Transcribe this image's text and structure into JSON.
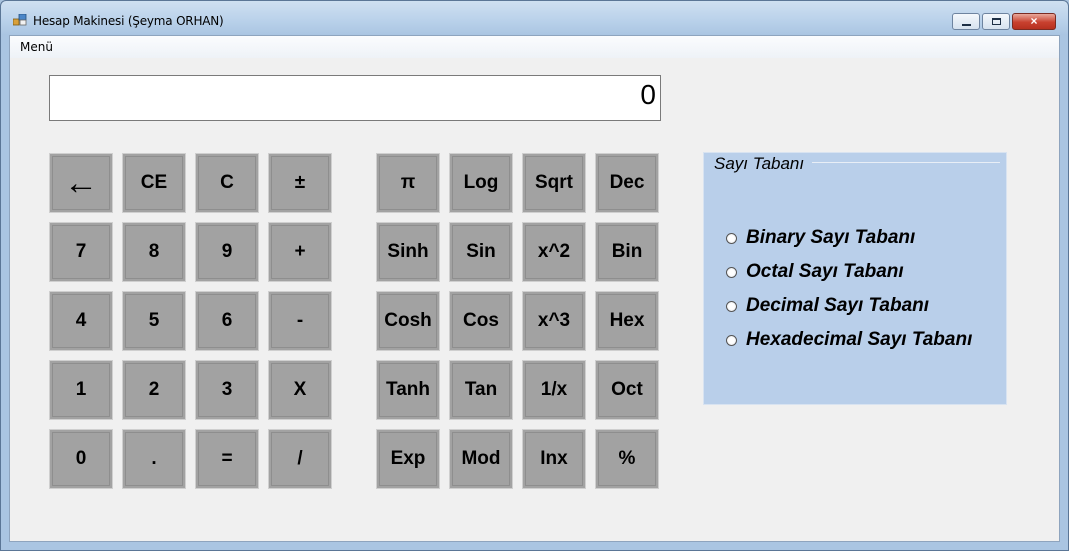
{
  "window": {
    "title": "Hesap Makinesi (Şeyma ORHAN)",
    "controls": {
      "minimize": "minimize-icon",
      "maximize": "maximize-icon",
      "close": "×"
    }
  },
  "menu": {
    "items": [
      "Menü"
    ]
  },
  "display": {
    "value": "0"
  },
  "keypad": {
    "basic": [
      [
        "←",
        "CE",
        "C",
        "±"
      ],
      [
        "7",
        "8",
        "9",
        "+"
      ],
      [
        "4",
        "5",
        "6",
        "-"
      ],
      [
        "1",
        "2",
        "3",
        "X"
      ],
      [
        "0",
        ".",
        "=",
        "/"
      ]
    ],
    "scientific": [
      [
        "π",
        "Log",
        "Sqrt",
        "Dec"
      ],
      [
        "Sinh",
        "Sin",
        "x^2",
        "Bin"
      ],
      [
        "Cosh",
        "Cos",
        "x^3",
        "Hex"
      ],
      [
        "Tanh",
        "Tan",
        "1/x",
        "Oct"
      ],
      [
        "Exp",
        "Mod",
        "Inx",
        "%"
      ]
    ]
  },
  "number_base": {
    "title": "Sayı Tabanı",
    "options": [
      "Binary Sayı Tabanı",
      "Octal Sayı Tabanı",
      "Decimal Sayı Tabanı",
      "Hexadecimal Sayı Tabanı"
    ]
  },
  "colors": {
    "button_face": "#a2a2a2",
    "groupbox_bg": "#b9cfea",
    "form_bg": "#f0f0f0"
  }
}
